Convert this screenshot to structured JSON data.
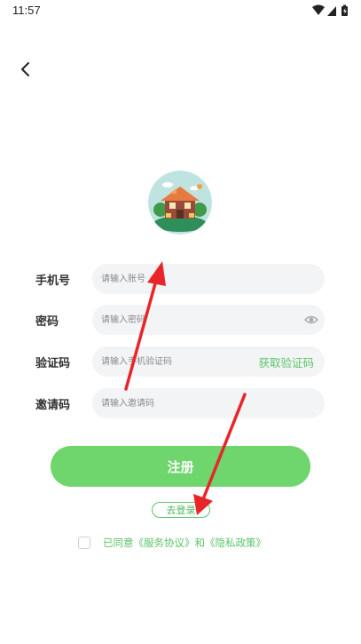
{
  "status": {
    "time": "11:57"
  },
  "form": {
    "phone": {
      "label": "手机号",
      "placeholder": "请输入账号"
    },
    "password": {
      "label": "密码",
      "placeholder": "请输入密码"
    },
    "code": {
      "label": "验证码",
      "placeholder": "请输入手机验证码",
      "button": "获取验证码"
    },
    "invite": {
      "label": "邀请码",
      "placeholder": "请输入邀请码"
    }
  },
  "actions": {
    "register": "注册",
    "go_login": "去登录"
  },
  "agreement": {
    "prefix": "已同意",
    "service": "《服务协议》",
    "and": "和",
    "privacy": "《隐私政策》"
  },
  "colors": {
    "accent": "#6ed66d",
    "link": "#5cc468",
    "field_bg": "#f3f4f6",
    "annotation": "#e8262a"
  },
  "icons": [
    "wifi-icon",
    "signal-icon",
    "battery-icon",
    "back-arrow-icon",
    "house-logo",
    "eye-icon"
  ]
}
